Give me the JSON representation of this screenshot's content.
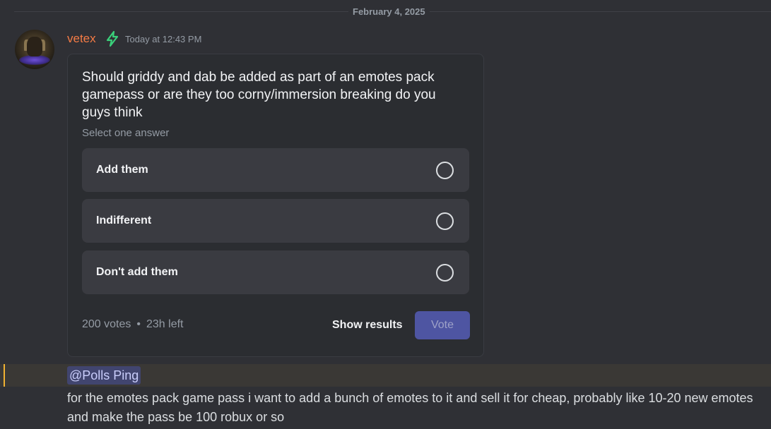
{
  "date_divider": "February 4, 2025",
  "author": {
    "name": "vetex",
    "timestamp": "Today at 12:43 PM",
    "name_color": "#f47b45",
    "badge_icon": "lightning-bolt-icon"
  },
  "poll": {
    "question": "Should griddy and dab be added as part of an emotes pack gamepass or are they too corny/immersion breaking do you guys think",
    "hint": "Select one answer",
    "answers": [
      {
        "label": "Add them"
      },
      {
        "label": "Indifferent"
      },
      {
        "label": "Don't add them"
      }
    ],
    "votes": "200 votes",
    "separator": "•",
    "time_left": "23h left",
    "show_results_label": "Show results",
    "vote_label": "Vote"
  },
  "mention": "@Polls Ping",
  "message": "for the emotes pack game pass i want to add a bunch of emotes to it and sell it for cheap, probably like 10-20 new emotes and make the pass be 100 robux or so",
  "colors": {
    "background": "#2f3035",
    "poll_card": "#2b2d31",
    "answer_bg": "#3a3b41",
    "vote_button": "#4e55a2",
    "mention_highlight": "#f0b232"
  }
}
